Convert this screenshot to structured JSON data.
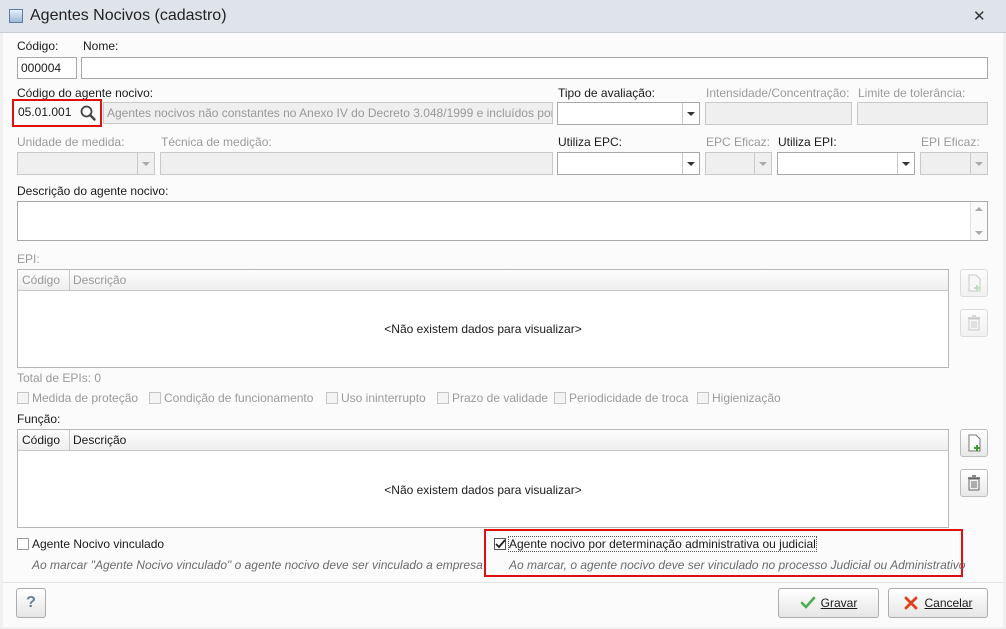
{
  "window": {
    "title": "Agentes Nocivos (cadastro)"
  },
  "codigo": {
    "label": "Código:",
    "value": "000004"
  },
  "nome": {
    "label": "Nome:",
    "value": ""
  },
  "codigo_agente": {
    "label": "Código do agente nocivo:",
    "value": "05.01.001",
    "description": "Agentes nocivos não constantes no Anexo IV do Decreto 3.048/1999 e incluídos por f"
  },
  "tipo_avaliacao": {
    "label": "Tipo de avaliação:",
    "value": ""
  },
  "intensidade": {
    "label": "Intensidade/Concentração:"
  },
  "limite": {
    "label": "Limite de tolerância:"
  },
  "unidade": {
    "label": "Unidade de medida:"
  },
  "tecnica": {
    "label": "Técnica de medição:"
  },
  "utiliza_epc": {
    "label": "Utiliza EPC:"
  },
  "epc_eficaz": {
    "label": "EPC Eficaz:"
  },
  "utiliza_epi": {
    "label": "Utiliza EPI:"
  },
  "epi_eficaz": {
    "label": "EPI Eficaz:"
  },
  "descricao": {
    "label": "Descrição do agente nocivo:"
  },
  "epi_grid": {
    "label": "EPI:",
    "columns": [
      "Código",
      "Descrição"
    ],
    "empty": "<Não existem dados para visualizar>",
    "total": "Total de EPIs: 0"
  },
  "epi_checks": [
    "Medida de proteção",
    "Condição de funcionamento",
    "Uso ininterrupto",
    "Prazo de validade",
    "Periodicidade de troca",
    "Higienização"
  ],
  "funcao_grid": {
    "label": "Função:",
    "columns": [
      "Código",
      "Descrição"
    ],
    "empty": "<Não existem dados para visualizar>"
  },
  "vinculado": {
    "label": "Agente Nocivo vinculado",
    "checked": false,
    "hint": "Ao marcar \"Agente Nocivo vinculado\" o agente nocivo deve ser vinculado a empresa"
  },
  "determinacao": {
    "label": "Agente nocivo por determinação administrativa ou judicial",
    "checked": true,
    "hint": "Ao marcar, o agente nocivo deve ser vinculado no processo Judicial ou Administrativo"
  },
  "footer": {
    "help": "?",
    "save": "Gravar",
    "cancel": "Cancelar"
  },
  "colors": {
    "highlight": "#e01010",
    "save_icon": "#4caf50",
    "cancel_icon": "#e0401a"
  }
}
